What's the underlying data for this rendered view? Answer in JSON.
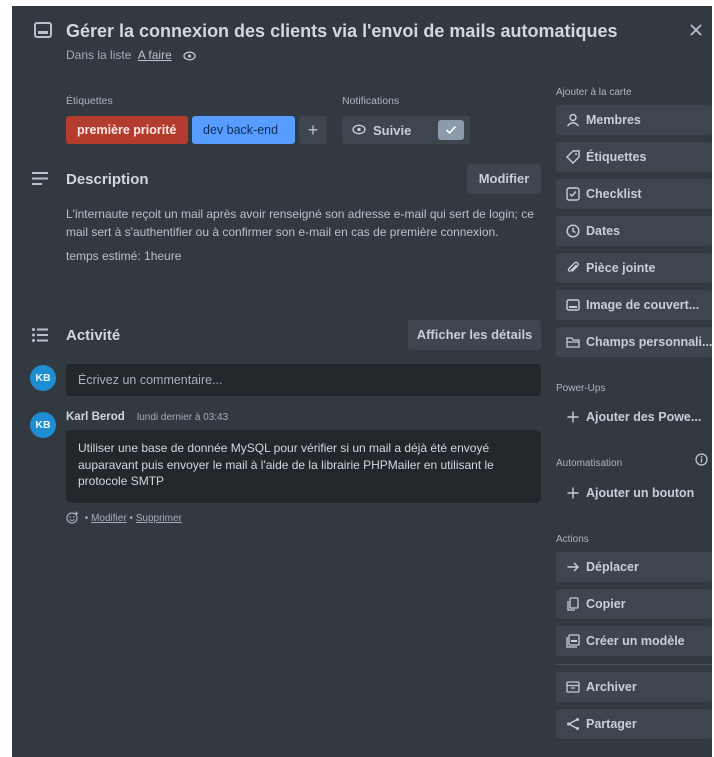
{
  "card": {
    "title": "Gérer la connexion des clients via l'envoi de mails automatiques",
    "in_list_prefix": "Dans la liste",
    "list_name": "A faire"
  },
  "labels": {
    "heading": "Étiquettes",
    "items": [
      {
        "text": "première priorité",
        "color": "#b43c2f"
      },
      {
        "text": "dev back-end",
        "color": "#579dff"
      }
    ],
    "add": "+"
  },
  "notifications": {
    "heading": "Notifications",
    "watch_label": "Suivie",
    "watching": true
  },
  "description": {
    "heading": "Description",
    "edit_label": "Modifier",
    "paragraph1": "L'internaute reçoit un mail après avoir renseigné son adresse e-mail qui sert de login; ce mail sert à s'authentifier ou à confirmer son e-mail en cas de première connexion.",
    "paragraph2": "temps estimé: 1heure"
  },
  "activity": {
    "heading": "Activité",
    "details_label": "Afficher les détails",
    "comment_placeholder": "Écrivez un commentaire...",
    "avatar_initials": "KB",
    "comment": {
      "author": "Karl Berod",
      "initials": "KB",
      "time": "lundi dernier à 03:43",
      "text": "Utiliser une base de donnée MySQL pour vérifier si un mail a déjà été envoyé auparavant puis envoyer le mail à l'aide de la librairie PHPMailer en utilisant le protocole SMTP",
      "edit": "Modifier",
      "delete": "Supprimer",
      "sep": "•"
    }
  },
  "sidebar": {
    "add_to_card": "Ajouter à la carte",
    "members": "Membres",
    "labels": "Étiquettes",
    "checklist": "Checklist",
    "dates": "Dates",
    "attachment": "Pièce jointe",
    "cover": "Image de couvert...",
    "custom_fields": "Champs personnali...",
    "powerups_heading": "Power-Ups",
    "add_powerups": "Ajouter des Powe...",
    "automation_heading": "Automatisation",
    "add_button": "Ajouter un bouton",
    "actions_heading": "Actions",
    "move": "Déplacer",
    "copy": "Copier",
    "template": "Créer un modèle",
    "archive": "Archiver",
    "share": "Partager"
  },
  "colors": {
    "card_bg": "#323940",
    "button_bg": "#3d454e",
    "input_bg": "#22272b",
    "avatar_bg": "#1d8fd1"
  }
}
